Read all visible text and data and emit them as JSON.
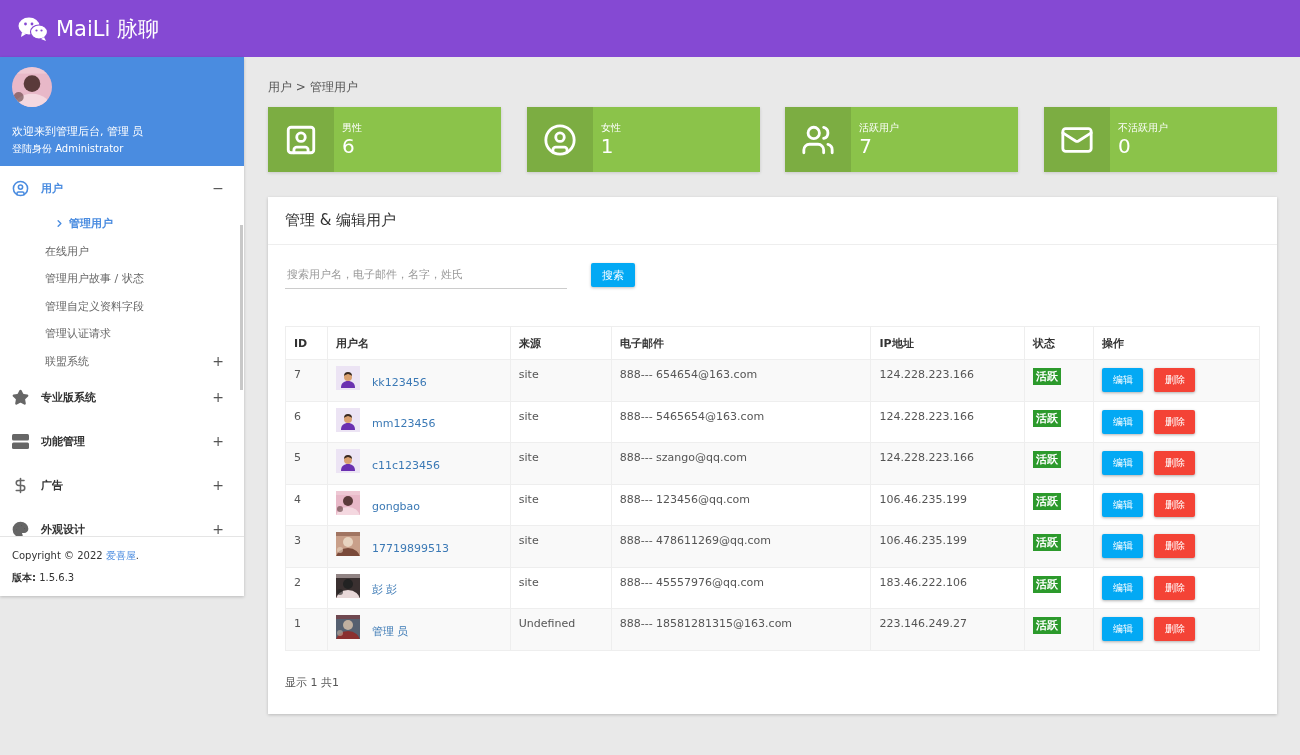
{
  "header": {
    "logo_text": "MaiLi 脉聊"
  },
  "sidebar": {
    "profile": {
      "welcome": "欢迎来到管理后台, 管理 员",
      "role": "登陆身份 Administrator"
    },
    "nav": [
      {
        "label": "用户",
        "toggle": "−",
        "expanded": true,
        "children": [
          {
            "label": "管理用户",
            "selected": true
          },
          {
            "label": "在线用户",
            "selected": false
          },
          {
            "label": "管理用户故事 / 状态",
            "selected": false
          },
          {
            "label": "管理自定义资料字段",
            "selected": false
          },
          {
            "label": "管理认证请求",
            "selected": false
          },
          {
            "label": "联盟系统",
            "selected": false,
            "toggle": "+"
          }
        ]
      },
      {
        "label": "专业版系统",
        "toggle": "+",
        "expanded": false
      },
      {
        "label": "功能管理",
        "toggle": "+",
        "expanded": false
      },
      {
        "label": "广告",
        "toggle": "+",
        "expanded": false
      },
      {
        "label": "外观设计",
        "toggle": "+",
        "expanded": false
      }
    ],
    "footer": {
      "copyright": "Copyright © 2022 ",
      "link": "爱喜屋",
      "after": ".",
      "version_label": "版本:",
      "version": "1.5.6.3"
    }
  },
  "breadcrumb": "用户 > 管理用户",
  "stats": [
    {
      "label": "男性",
      "value": "6"
    },
    {
      "label": "女性",
      "value": "1"
    },
    {
      "label": "活跃用户",
      "value": "7"
    },
    {
      "label": "不活跃用户",
      "value": "0"
    }
  ],
  "panel": {
    "title": "管理 & 编辑用户",
    "search": {
      "placeholder": "搜索用户名，电子邮件，名字，姓氏"
    },
    "search_button": "搜索",
    "table": {
      "columns": [
        "ID",
        "用户名",
        "来源",
        "电子邮件",
        "IP地址",
        "状态",
        "操作"
      ],
      "rows": [
        {
          "id": "7",
          "kind": "cartoon",
          "username": "kk123456",
          "source": "site",
          "email": "888--- 654654@163.com",
          "ip": "124.228.223.166",
          "status": "活跃",
          "actions": [
            "编辑",
            "删除"
          ]
        },
        {
          "id": "6",
          "kind": "cartoon",
          "username": "mm123456",
          "source": "site",
          "email": "888--- 5465654@163.com",
          "ip": "124.228.223.166",
          "status": "活跃",
          "actions": [
            "编辑",
            "删除"
          ]
        },
        {
          "id": "5",
          "kind": "cartoon",
          "username": "c11c123456",
          "source": "site",
          "email": "888--- szango@qq.com",
          "ip": "124.228.223.166",
          "status": "活跃",
          "actions": [
            "编辑",
            "删除"
          ]
        },
        {
          "id": "4",
          "kind": "picture",
          "username": "gongbao",
          "source": "site",
          "email": "888--- 123456@qq.com",
          "ip": "106.46.235.199",
          "status": "活跃",
          "actions": [
            "编辑",
            "删除"
          ]
        },
        {
          "id": "3",
          "kind": "picture",
          "username": "17719899513",
          "source": "site",
          "email": "888--- 478611269@qq.com",
          "ip": "106.46.235.199",
          "status": "活跃",
          "actions": [
            "编辑",
            "删除"
          ]
        },
        {
          "id": "2",
          "kind": "picture",
          "username": "彭 彭",
          "source": "site",
          "email": "888--- 45557976@qq.com",
          "ip": "183.46.222.106",
          "status": "活跃",
          "actions": [
            "编辑",
            "删除"
          ]
        },
        {
          "id": "1",
          "kind": "picture",
          "username": "管理 员",
          "source": "Undefined",
          "email": "888--- 18581281315@163.com",
          "ip": "223.146.249.27",
          "status": "活跃",
          "actions": [
            "编辑",
            "删除"
          ]
        }
      ]
    },
    "summary": "显示 1 共1"
  }
}
